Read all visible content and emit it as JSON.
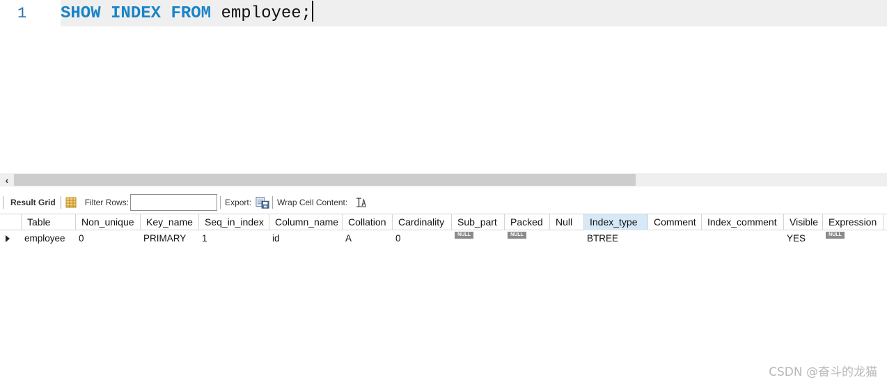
{
  "editor": {
    "line_number": "1",
    "keywords": [
      "SHOW",
      "INDEX",
      "FROM"
    ],
    "identifier": "employee;"
  },
  "toolbar": {
    "result_grid_label": "Result Grid",
    "filter_rows_label": "Filter Rows:",
    "filter_value": "",
    "export_label": "Export:",
    "wrap_label": "Wrap Cell Content:"
  },
  "grid": {
    "columns": [
      "Table",
      "Non_unique",
      "Key_name",
      "Seq_in_index",
      "Column_name",
      "Collation",
      "Cardinality",
      "Sub_part",
      "Packed",
      "Null",
      "Index_type",
      "Comment",
      "Index_comment",
      "Visible",
      "Expression"
    ],
    "sorted_column": "Index_type",
    "rows": [
      {
        "Table": "employee",
        "Non_unique": "0",
        "Key_name": "PRIMARY",
        "Seq_in_index": "1",
        "Column_name": "id",
        "Collation": "A",
        "Cardinality": "0",
        "Sub_part": "NULL",
        "Packed": "NULL",
        "Null": "",
        "Index_type": "BTREE",
        "Comment": "",
        "Index_comment": "",
        "Visible": "YES",
        "Expression": "NULL"
      }
    ]
  },
  "colors": {
    "keyword": "#1a84c7",
    "sorted_header": "#d7e8f6",
    "null_badge": "#8a8a8a"
  },
  "watermark": "CSDN @奋斗的龙猫"
}
